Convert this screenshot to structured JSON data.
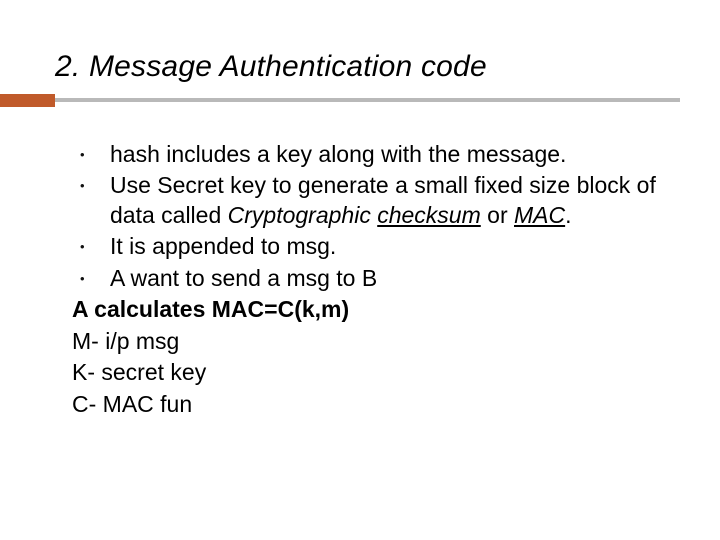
{
  "title": "2. Message Authentication code",
  "bullets": [
    "hash includes a key along with the message.",
    {
      "pre": "Use Secret key to generate a small fixed size block of data called ",
      "em": "Cryptographic ",
      "u1": "checksum",
      "mid": " or ",
      "u2": "MAC",
      "post": "."
    },
    "It is appended to msg.",
    "A want to send a msg to B"
  ],
  "lines": {
    "l1": "A calculates MAC=C(k,m)",
    "l2": "M- i/p msg",
    "l3": "K- secret key",
    "l4": "C- MAC fun"
  }
}
